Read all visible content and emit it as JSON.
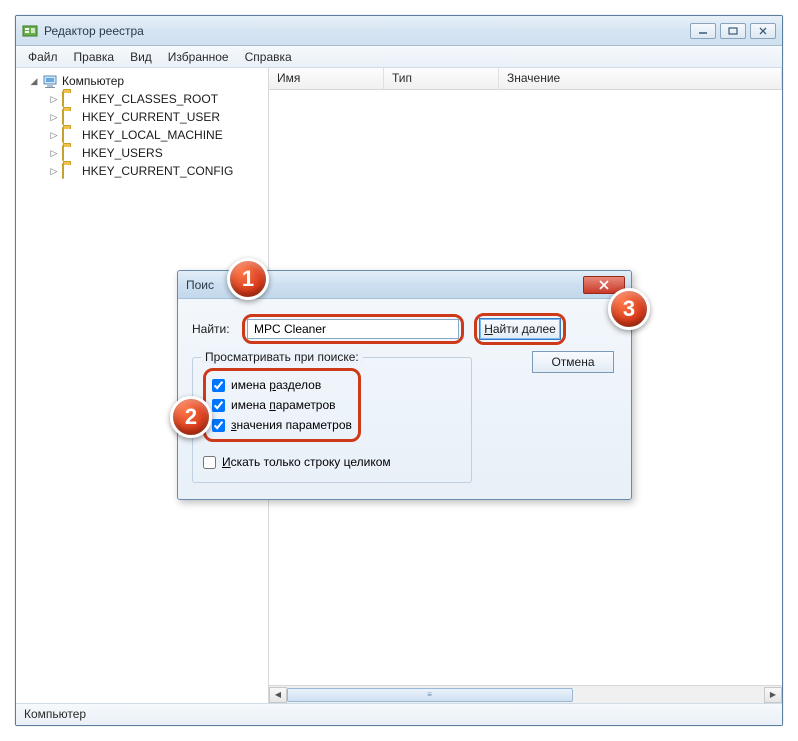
{
  "window": {
    "title": "Редактор реестра",
    "menu": [
      "Файл",
      "Правка",
      "Вид",
      "Избранное",
      "Справка"
    ],
    "statusbar": "Компьютер"
  },
  "tree": {
    "root": "Компьютер",
    "hives": [
      "HKEY_CLASSES_ROOT",
      "HKEY_CURRENT_USER",
      "HKEY_LOCAL_MACHINE",
      "HKEY_USERS",
      "HKEY_CURRENT_CONFIG"
    ]
  },
  "list_columns": {
    "name": "Имя",
    "type": "Тип",
    "value": "Значение"
  },
  "dialog": {
    "title": "Поис",
    "find_label": "Найти:",
    "find_value": "MPC Cleaner",
    "btn_find_next_prefix": "Н",
    "btn_find_next_rest": "айти далее",
    "btn_cancel": "Отмена",
    "group_legend": "Просматривать при поиске:",
    "chk_keys_prefix": "имена ",
    "chk_keys_u": "р",
    "chk_keys_rest": "азделов",
    "chk_values_prefix": "имена ",
    "chk_values_u": "п",
    "chk_values_rest": "араметров",
    "chk_data_u": "з",
    "chk_data_rest": "начения параметров",
    "chk_whole_u": "И",
    "chk_whole_rest": "скать только строку целиком"
  },
  "badges": {
    "b1": "1",
    "b2": "2",
    "b3": "3"
  }
}
